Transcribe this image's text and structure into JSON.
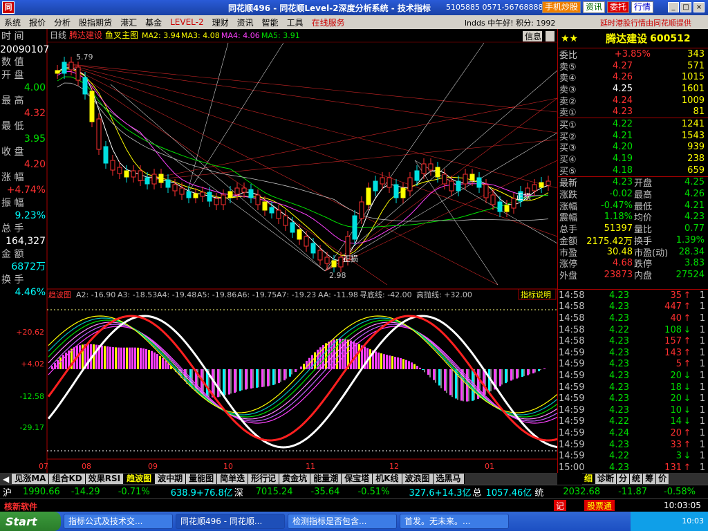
{
  "titlebar": {
    "logo": "同",
    "title": "同花顺496 - 同花顺Level-2深度分析系统 - 技术指标",
    "phone": "5105885  0571-56768888",
    "btn_mobile": "手机炒股",
    "btn_info": "资讯",
    "btn_trade": "委托",
    "btn_quote": "行情"
  },
  "menu": {
    "items": [
      "系统",
      "报价",
      "分析",
      "股指期货",
      "港汇",
      "基金",
      "LEVEL-2",
      "理财",
      "资讯",
      "智能",
      "工具",
      "在线服务"
    ],
    "user": "lndds 中午好! 积分: 1992",
    "notice": "延时港股行情由同花顺提供"
  },
  "chart": {
    "period": "日线",
    "stock_name": "腾达建设",
    "main_indicator": "鱼叉主图",
    "ma_labels": [
      "MA2: 3.94",
      "MA3: 4.08",
      "MA4: 4.06",
      "MA5: 3.91"
    ],
    "info_btn": "信息",
    "high_mark": "5.79",
    "low_mark": "2.98",
    "mark1": "正损",
    "mark2": "正损",
    "mark3": "正损",
    "sub_indicator": "趋波图",
    "sub_labels": [
      "A2: -16.90",
      "A3: -18.53",
      "A4: -19.48",
      "A5: -19.86",
      "A6: -19.75",
      "A7: -19.23",
      "AA: -11.98",
      "寻底线: -42.00",
      "高抛线: +32.00"
    ],
    "sub_btn": "指标说明",
    "sub_axis": [
      "+20.62",
      "+4.02",
      "-12.58",
      "-29.17"
    ],
    "x_axis": [
      "07",
      "08",
      "09",
      "10",
      "11",
      "12",
      "01"
    ]
  },
  "leftinfo": {
    "time_label": "时 间",
    "date": "20090107",
    "num_label": "数 值",
    "open_label": "开 盘",
    "open": "4.00",
    "high_label": "最 高",
    "high": "4.32",
    "low_label": "最 低",
    "low": "3.95",
    "close_label": "收 盘",
    "close": "4.20",
    "chg_label": "涨 幅",
    "chg": "+4.74%",
    "amp_label": "振 幅",
    "amp": "9.23%",
    "vol_label": "总 手",
    "vol": "164,327",
    "amt_label": "金 额",
    "amt": "6872万",
    "turn_label": "换 手",
    "turn": "4.46%"
  },
  "quote": {
    "name": "腾达建设",
    "code": "600512",
    "ratio_label": "委比",
    "ratio": "+3.85%",
    "ratio_vol": "343",
    "sells": [
      {
        "l": "卖⑤",
        "p": "4.27",
        "v": "571"
      },
      {
        "l": "卖④",
        "p": "4.26",
        "v": "1015"
      },
      {
        "l": "卖③",
        "p": "4.25",
        "v": "1601"
      },
      {
        "l": "卖②",
        "p": "4.24",
        "v": "1009"
      },
      {
        "l": "卖①",
        "p": "4.23",
        "v": "81"
      }
    ],
    "buys": [
      {
        "l": "买①",
        "p": "4.22",
        "v": "1241"
      },
      {
        "l": "买②",
        "p": "4.21",
        "v": "1543"
      },
      {
        "l": "买③",
        "p": "4.20",
        "v": "939"
      },
      {
        "l": "买④",
        "p": "4.19",
        "v": "238"
      },
      {
        "l": "买⑤",
        "p": "4.18",
        "v": "659"
      }
    ],
    "stats": [
      [
        "最新",
        "4.23",
        "开盘",
        "4.25"
      ],
      [
        "涨跌",
        "-0.02",
        "最高",
        "4.26"
      ],
      [
        "涨幅",
        "-0.47%",
        "最低",
        "4.21"
      ],
      [
        "震幅",
        "1.18%",
        "均价",
        "4.23"
      ],
      [
        "总手",
        "51397",
        "量比",
        "0.77"
      ],
      [
        "金额",
        "2175.42万",
        "换手",
        "1.39%"
      ],
      [
        "市盈",
        "30.48",
        "市盈(动)",
        "28.34"
      ],
      [
        "涨停",
        "4.68",
        "跌停",
        "3.83"
      ],
      [
        "外盘",
        "23873",
        "内盘",
        "27524"
      ]
    ]
  },
  "ticks": [
    [
      "14:58",
      "4.23",
      "35",
      "up",
      "1"
    ],
    [
      "14:58",
      "4.23",
      "447",
      "up",
      "1"
    ],
    [
      "14:58",
      "4.23",
      "40",
      "up",
      "1"
    ],
    [
      "14:58",
      "4.22",
      "108",
      "down",
      "1"
    ],
    [
      "14:58",
      "4.23",
      "157",
      "up",
      "1"
    ],
    [
      "14:59",
      "4.23",
      "143",
      "up",
      "1"
    ],
    [
      "14:59",
      "4.23",
      "5",
      "up",
      "1"
    ],
    [
      "14:59",
      "4.23",
      "20",
      "down",
      "1"
    ],
    [
      "14:59",
      "4.23",
      "18",
      "down",
      "1"
    ],
    [
      "14:59",
      "4.23",
      "20",
      "down",
      "1"
    ],
    [
      "14:59",
      "4.23",
      "10",
      "down",
      "1"
    ],
    [
      "14:59",
      "4.22",
      "14",
      "down",
      "1"
    ],
    [
      "14:59",
      "4.24",
      "20",
      "up",
      "1"
    ],
    [
      "14:59",
      "4.23",
      "33",
      "up",
      "1"
    ],
    [
      "14:59",
      "4.22",
      "3",
      "down",
      "1"
    ],
    [
      "15:00",
      "4.23",
      "131",
      "up",
      "1"
    ]
  ],
  "tabs": [
    "见涨MA",
    "组合KD",
    "效果RSI",
    "趋波图",
    "波中期",
    "量能图",
    "简单迭",
    "形行记",
    "黄金坑",
    "能量潮",
    "保宝塔",
    "机K线",
    "波浪图",
    "选黑马"
  ],
  "active_tab": "趋波图",
  "rtabs": [
    "细",
    "诊断",
    "分",
    "统",
    "筹",
    "价"
  ],
  "indexbar": {
    "sh_label": "沪",
    "sh": "1990.66",
    "sh_chg": "-14.29",
    "sh_pct": "-0.71%",
    "sh_amt": "638.9+76.8亿",
    "sz_label": "深",
    "sz": "7015.24",
    "sz_chg": "-35.64",
    "sz_pct": "-0.51%",
    "sz_amt": "327.6+14.3亿",
    "total_label": "总",
    "total": "1057.46亿",
    "tong_label": "统",
    "tong": "2032.68",
    "tong_chg": "-11.87",
    "tong_pct": "-0.58%"
  },
  "status": {
    "left": "核新软件",
    "btn1": "记",
    "btn2": "股票通",
    "clock": "10:03:05"
  },
  "taskbar": {
    "start": "Start",
    "tasks": [
      "指标公式及技术交...",
      "同花顺496 - 同花顺...",
      "检测指标是否包含...",
      "首发。无未来。..."
    ],
    "clock": "10:03"
  }
}
